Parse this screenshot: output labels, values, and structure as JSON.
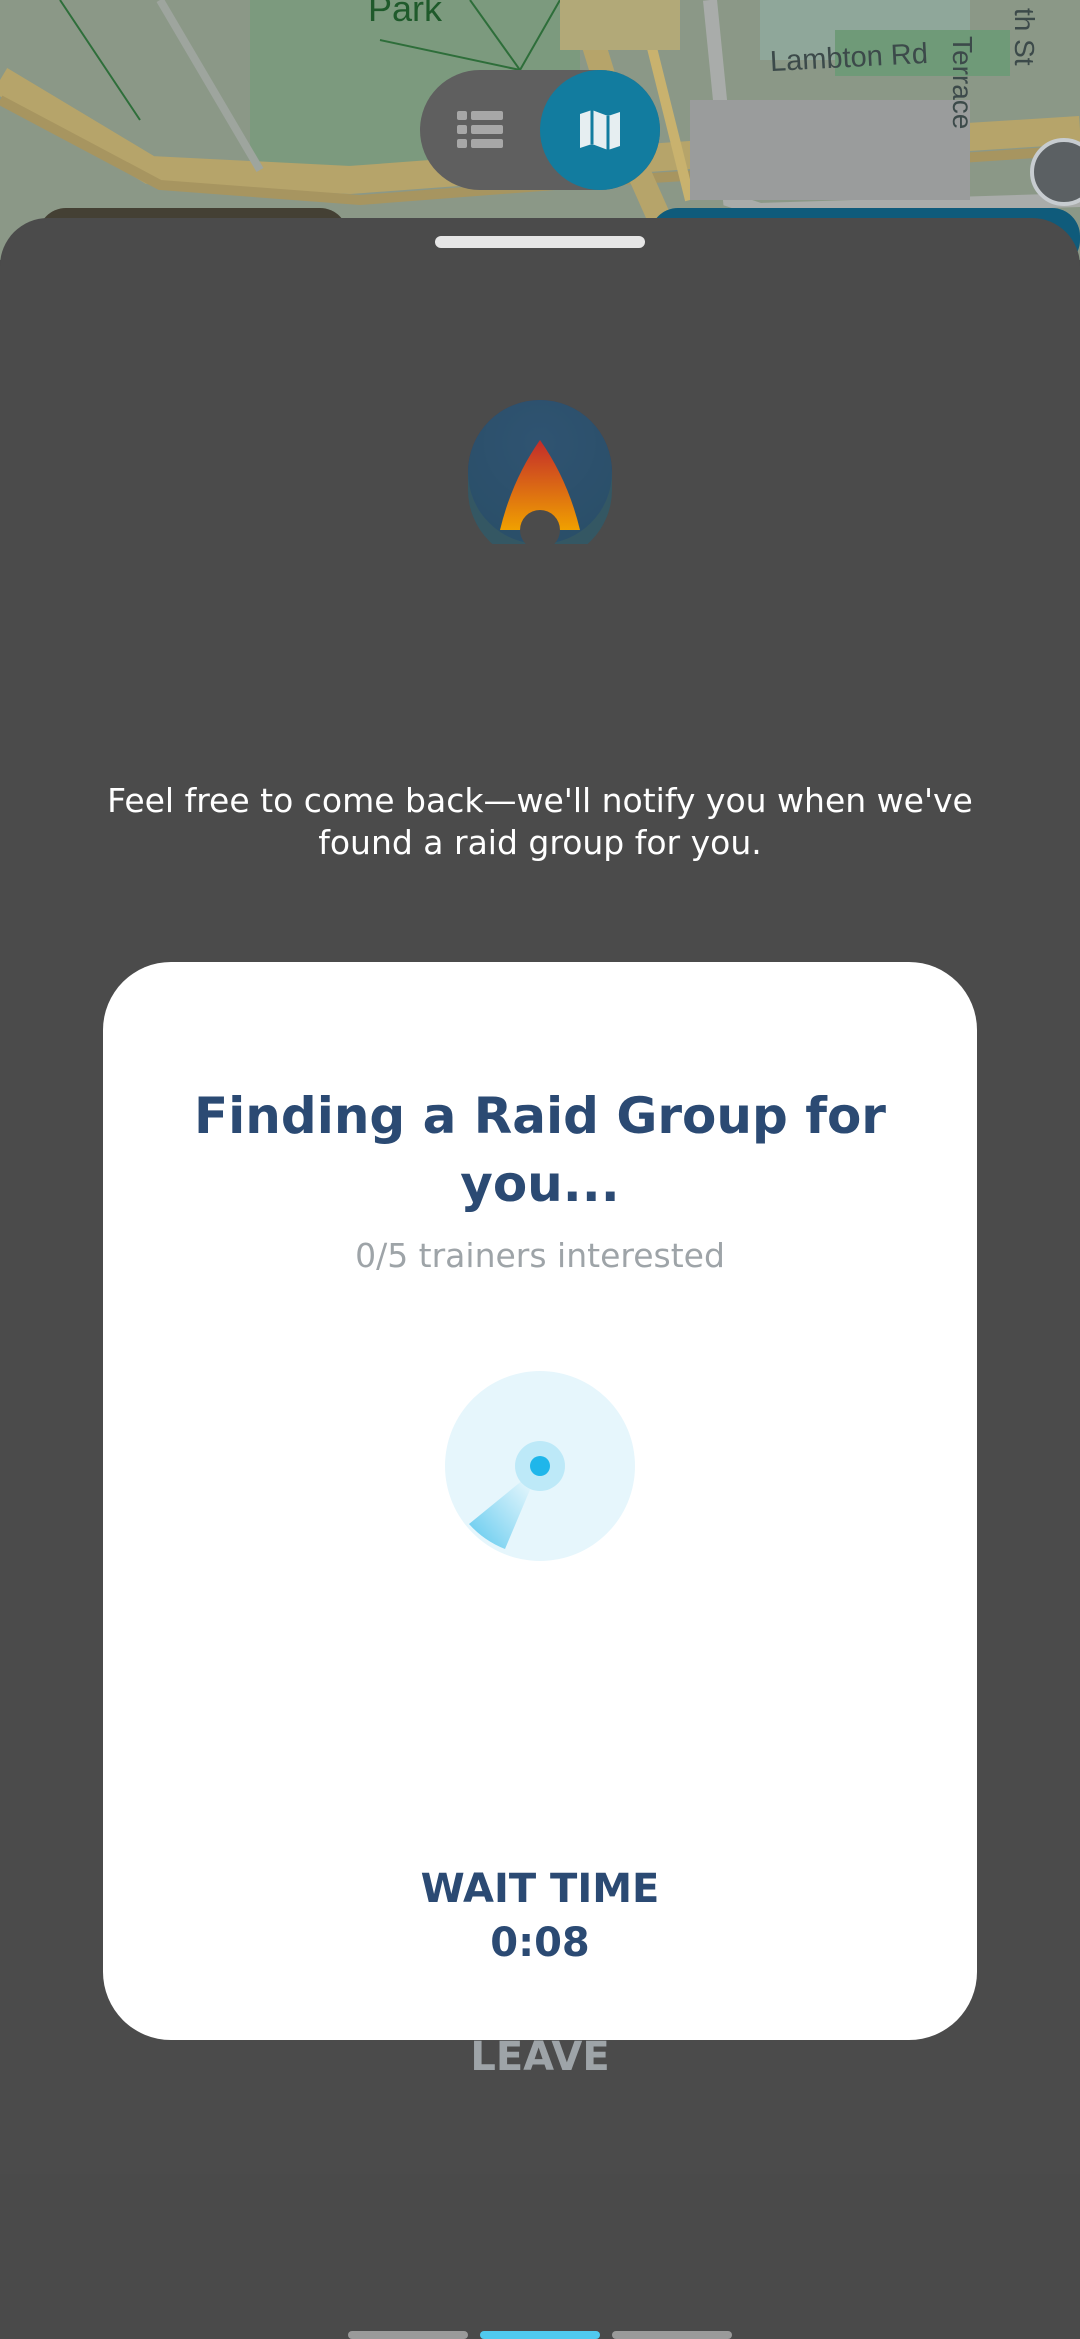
{
  "map": {
    "labels": {
      "park": "Park",
      "lambton": "Lambton Rd",
      "terrace": "Terrace",
      "street": "th St"
    }
  },
  "view_toggle": {
    "list_icon": "list-icon",
    "map_icon": "map-icon",
    "selected": "map"
  },
  "sheet": {
    "raid_icon": "raid-egg-icon",
    "notify_text": "Feel free to come back—we'll notify you when we've found a raid group for you."
  },
  "card": {
    "title": "Finding a Raid Group for you...",
    "subtitle": "0/5 trainers interested",
    "radar_icon": "radar-icon",
    "wait_label": "WAIT TIME",
    "wait_value": "0:08",
    "leave_label": "LEAVE"
  },
  "pager": {
    "count": 3,
    "active_index": 1
  },
  "colors": {
    "sheet_background": "#4b4b4b",
    "card_title": "#2b4a73",
    "muted_text": "#9ea4a8",
    "accent": "#127c9f",
    "pager_active": "#4fc9ef"
  }
}
